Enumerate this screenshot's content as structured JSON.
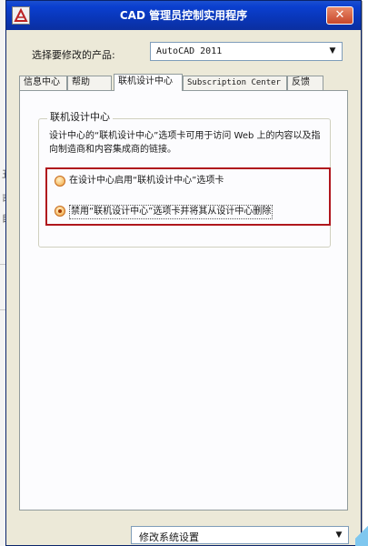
{
  "window": {
    "title": "CAD 管理员控制实用程序",
    "close_label": "✕"
  },
  "product": {
    "label": "选择要修改的产品:",
    "selected": "AutoCAD 2011"
  },
  "tabs": [
    {
      "label": "信息中心"
    },
    {
      "label": "帮助"
    },
    {
      "label": "联机设计中心",
      "active": true
    },
    {
      "label": "Subscription Center"
    },
    {
      "label": "反馈"
    }
  ],
  "panel": {
    "group_title": "联机设计中心",
    "description": "设计中心的“联机设计中心”选项卡可用于访问 Web 上的内容以及指向制造商和内容集成商的链接。",
    "options": [
      {
        "label": "在设计中心启用“联机设计中心”选项卡",
        "checked": false
      },
      {
        "label": "禁用“联机设计中心”选项卡并将其从设计中心删除",
        "checked": true
      }
    ]
  },
  "bottom": {
    "setting_selected": "修改系统设置"
  },
  "colors": {
    "title_bar": "#0a3fcf",
    "highlight_border": "#b0171d"
  }
}
